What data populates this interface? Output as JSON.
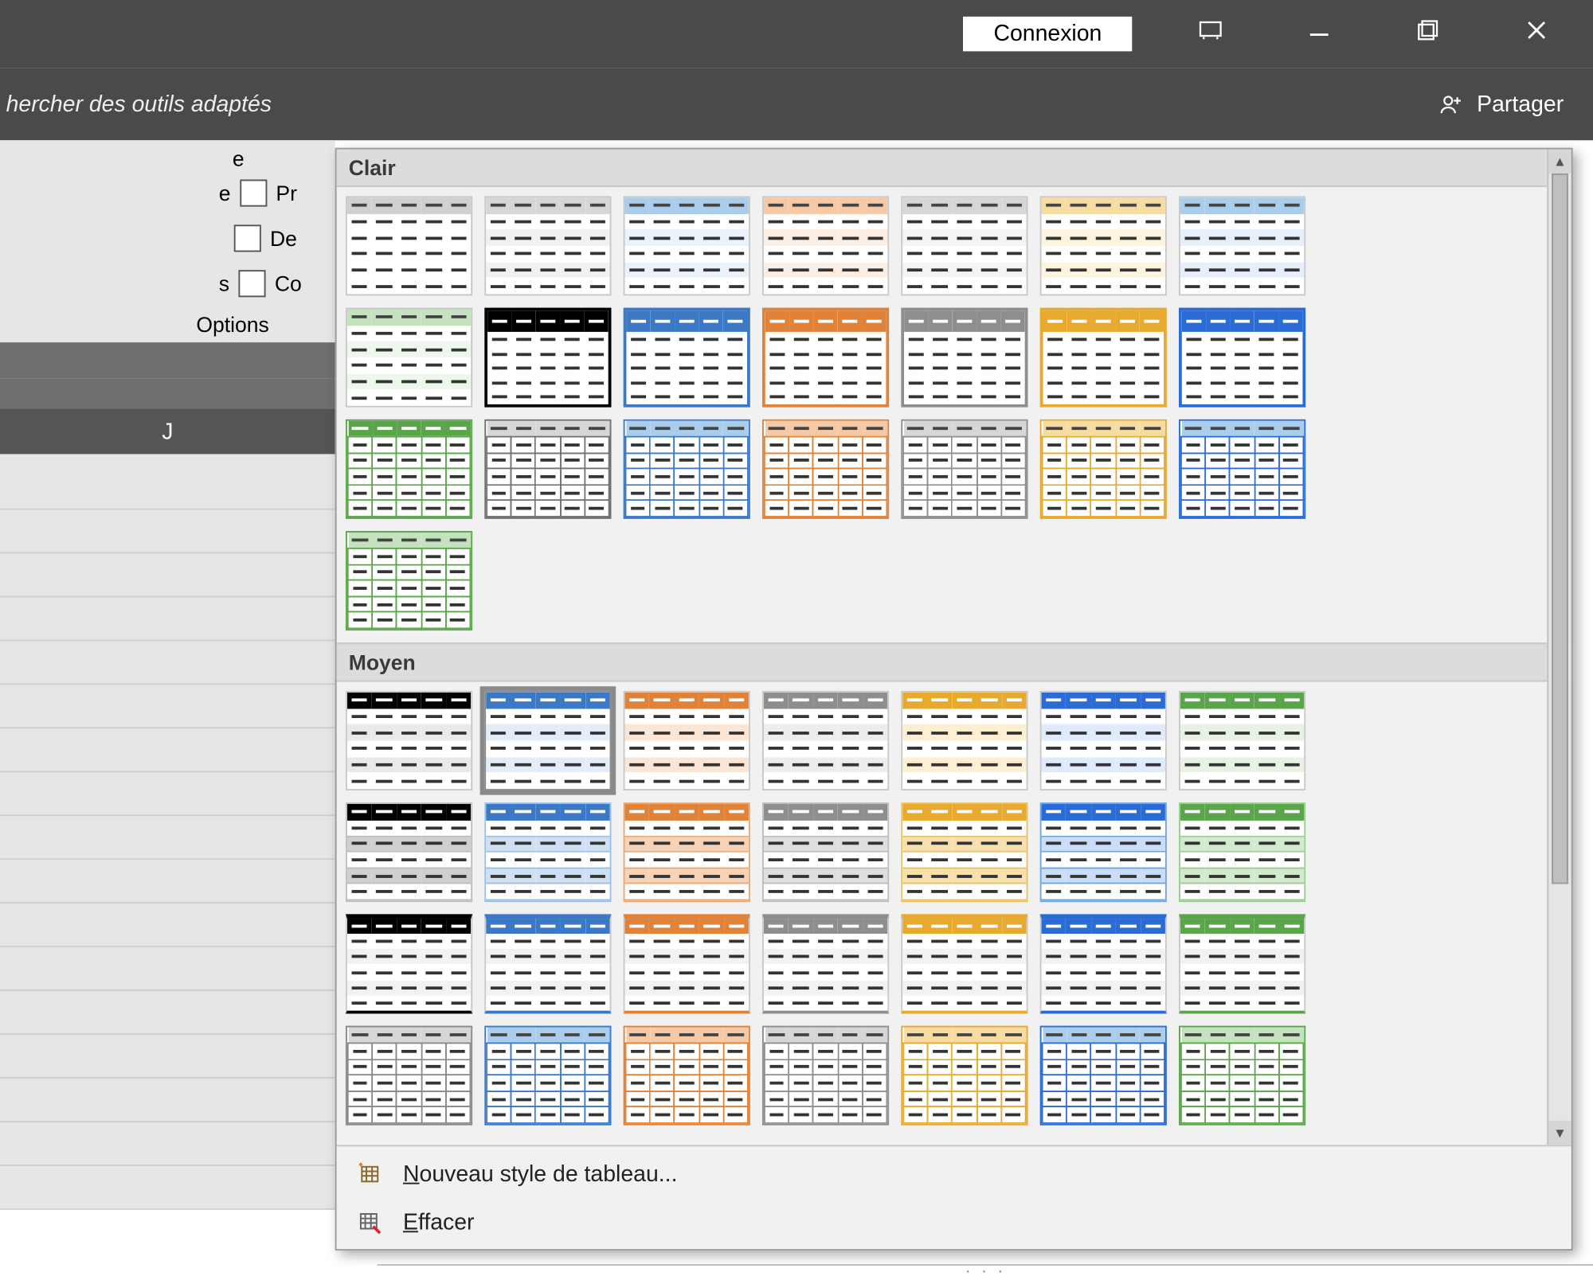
{
  "titlebar": {
    "signin_label": "Connexion"
  },
  "ribbon": {
    "search_hint": "hercher des outils adaptés",
    "share_label": "Partager"
  },
  "options_group": {
    "label": "Options",
    "checks": [
      {
        "label": "Pr"
      },
      {
        "label": "De"
      },
      {
        "label": "Co"
      }
    ]
  },
  "column_letter": "J",
  "gallery": {
    "section_light": "Clair",
    "section_medium": "Moyen",
    "footer_new": "Nouveau style de tableau...",
    "footer_clear": "Effacer"
  },
  "palette": {
    "none": "#d0d0d0",
    "black": "#000000",
    "blue": "#3b78c6",
    "lblue": "#a9cdea",
    "orange": "#e08238",
    "lorange": "#f5c9a6",
    "grey": "#8e8e8e",
    "lgrey": "#d6d6d6",
    "gold": "#e7a92e",
    "lgold": "#f6dca1",
    "bblue": "#2a6bd6",
    "green": "#5aa54a",
    "lgreen": "#c4e2bd"
  },
  "light_rows": [
    [
      {
        "hdr": "none",
        "band": "#ffffff",
        "bd": "#ffffff"
      },
      {
        "hdr": "lgrey",
        "band": "#f1f1f1",
        "bd": "#c8c8c8"
      },
      {
        "hdr": "lblue",
        "band": "#eaf2fb",
        "bd": "#8fb9e4"
      },
      {
        "hdr": "lorange",
        "band": "#fdeee3",
        "bd": "#e9a877"
      },
      {
        "hdr": "lgrey",
        "band": "#f4f4f4",
        "bd": "#bcbcbc"
      },
      {
        "hdr": "lgold",
        "band": "#fdf3df",
        "bd": "#e7c165"
      },
      {
        "hdr": "lblue",
        "band": "#e6effb",
        "bd": "#6fa4e2"
      }
    ],
    [
      {
        "hdr": "lgreen",
        "band": "#eef7ec",
        "bd": "#9acc8f",
        "fill": true
      },
      {
        "hdr": "black",
        "band": "#ffffff",
        "bd": "#000000",
        "thick": true
      },
      {
        "hdr": "blue",
        "band": "#ffffff",
        "bd": "#3b78c6",
        "thick": true
      },
      {
        "hdr": "orange",
        "band": "#ffffff",
        "bd": "#e08238",
        "thick": true
      },
      {
        "hdr": "grey",
        "band": "#ffffff",
        "bd": "#8e8e8e",
        "thick": true
      },
      {
        "hdr": "gold",
        "band": "#ffffff",
        "bd": "#e7a92e",
        "thick": true
      },
      {
        "hdr": "bblue",
        "band": "#ffffff",
        "bd": "#2a6bd6",
        "thick": true
      }
    ],
    [
      {
        "hdr": "green",
        "band": "#ffffff",
        "bd": "#5aa54a",
        "grid": true
      },
      {
        "hdr": "lgrey",
        "band": "#ffffff",
        "bd": "#707070",
        "grid": true
      },
      {
        "hdr": "lblue",
        "band": "#ffffff",
        "bd": "#3b78c6",
        "grid": true
      },
      {
        "hdr": "lorange",
        "band": "#ffffff",
        "bd": "#e08238",
        "grid": true
      },
      {
        "hdr": "lgrey",
        "band": "#ffffff",
        "bd": "#8e8e8e",
        "grid": true
      },
      {
        "hdr": "lgold",
        "band": "#ffffff",
        "bd": "#e7a92e",
        "grid": true
      },
      {
        "hdr": "lblue",
        "band": "#ffffff",
        "bd": "#2a6bd6",
        "grid": true
      }
    ],
    [
      {
        "hdr": "lgreen",
        "band": "#ffffff",
        "bd": "#5aa54a",
        "grid": true
      }
    ]
  ],
  "medium_rows": [
    [
      {
        "hdr": "black",
        "band": "#e9e9e9",
        "bd": "#bdbdbd"
      },
      {
        "hdr": "blue",
        "band": "#e3edf8",
        "bd": "#9bc0e6",
        "selected": true
      },
      {
        "hdr": "orange",
        "band": "#fbe6d6",
        "bd": "#e9a877"
      },
      {
        "hdr": "grey",
        "band": "#ededed",
        "bd": "#bcbcbc"
      },
      {
        "hdr": "gold",
        "band": "#fcefd2",
        "bd": "#e7c165"
      },
      {
        "hdr": "bblue",
        "band": "#dfeafc",
        "bd": "#6fa4e2"
      },
      {
        "hdr": "green",
        "band": "#e7f2e4",
        "bd": "#9acc8f"
      }
    ],
    [
      {
        "hdr": "black",
        "band": "#cfcfcf",
        "bd": "#bdbdbd",
        "boxed": true
      },
      {
        "hdr": "blue",
        "band": "#cfe0f3",
        "bd": "#9bc0e6",
        "boxed": true
      },
      {
        "hdr": "orange",
        "band": "#f6d3b7",
        "bd": "#e9a877",
        "boxed": true
      },
      {
        "hdr": "grey",
        "band": "#dedede",
        "bd": "#bcbcbc",
        "boxed": true
      },
      {
        "hdr": "gold",
        "band": "#f7e0ab",
        "bd": "#e7c165",
        "boxed": true
      },
      {
        "hdr": "bblue",
        "band": "#c9ddf8",
        "bd": "#6fa4e2",
        "boxed": true
      },
      {
        "hdr": "green",
        "band": "#d3e9cd",
        "bd": "#9acc8f",
        "boxed": true
      }
    ],
    [
      {
        "hdr": "black",
        "band": "#f2f2f2",
        "bd": "#000000",
        "thicktop": true
      },
      {
        "hdr": "blue",
        "band": "#f2f2f2",
        "bd": "#3b78c6",
        "thicktop": true
      },
      {
        "hdr": "orange",
        "band": "#f2f2f2",
        "bd": "#e08238",
        "thicktop": true
      },
      {
        "hdr": "grey",
        "band": "#f2f2f2",
        "bd": "#8e8e8e",
        "thicktop": true
      },
      {
        "hdr": "gold",
        "band": "#f2f2f2",
        "bd": "#e7a92e",
        "thicktop": true
      },
      {
        "hdr": "bblue",
        "band": "#f2f2f2",
        "bd": "#2a6bd6",
        "thicktop": true
      },
      {
        "hdr": "green",
        "band": "#f2f2f2",
        "bd": "#5aa54a",
        "thicktop": true
      }
    ],
    [
      {
        "hdr": "lgrey",
        "band": "#e4e4e4",
        "bd": "#888888",
        "grid": true
      },
      {
        "hdr": "lblue",
        "band": "#d9e8f7",
        "bd": "#3b78c6",
        "grid": true
      },
      {
        "hdr": "lorange",
        "band": "#f8e0cc",
        "bd": "#e08238",
        "grid": true
      },
      {
        "hdr": "lgrey",
        "band": "#ececec",
        "bd": "#8e8e8e",
        "grid": true
      },
      {
        "hdr": "lgold",
        "band": "#f9e9c4",
        "bd": "#e7a92e",
        "grid": true
      },
      {
        "hdr": "lblue",
        "band": "#d5e5fb",
        "bd": "#2a6bd6",
        "grid": true
      },
      {
        "hdr": "lgreen",
        "band": "#def0d9",
        "bd": "#5aa54a",
        "grid": true
      }
    ]
  ]
}
